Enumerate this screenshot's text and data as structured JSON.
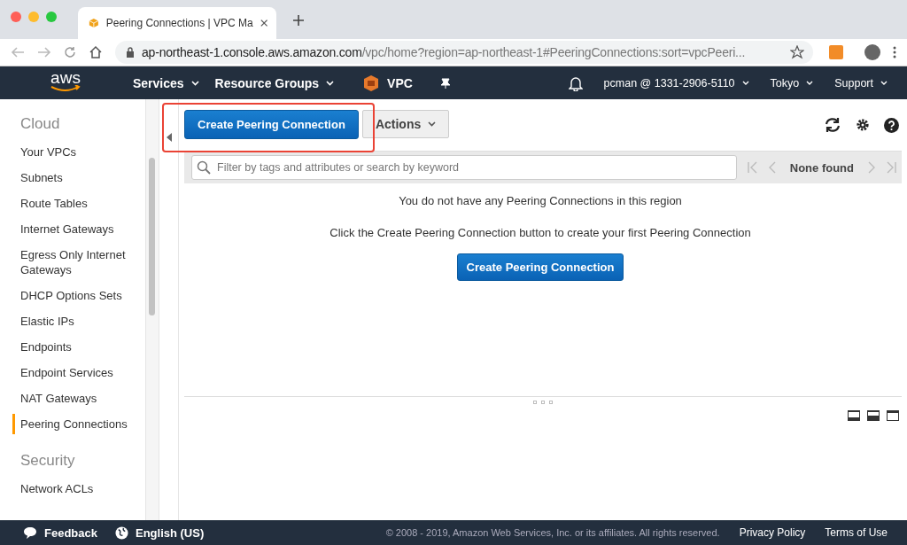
{
  "browser": {
    "tab_title": "Peering Connections | VPC Ma",
    "url_host": "ap-northeast-1.console.aws.amazon.com",
    "url_path": "/vpc/home?region=ap-northeast-1#PeeringConnections:sort=vpcPeeri..."
  },
  "nav": {
    "logo": "aws",
    "items": [
      {
        "label": "Services",
        "dropdown": true
      },
      {
        "label": "Resource Groups",
        "dropdown": true
      }
    ],
    "service": "VPC",
    "right": [
      {
        "label": "pcman @ 1331-2906-5110"
      },
      {
        "label": "Tokyo"
      },
      {
        "label": "Support"
      }
    ]
  },
  "sidebar": {
    "sections": [
      {
        "heading": "Cloud",
        "items": [
          {
            "label": "Your VPCs",
            "selected": false
          },
          {
            "label": "Subnets",
            "selected": false
          },
          {
            "label": "Route Tables",
            "selected": false
          },
          {
            "label": "Internet Gateways",
            "selected": false
          },
          {
            "label": "Egress Only Internet Gateways",
            "selected": false
          },
          {
            "label": "DHCP Options Sets",
            "selected": false
          },
          {
            "label": "Elastic IPs",
            "selected": false
          },
          {
            "label": "Endpoints",
            "selected": false
          },
          {
            "label": "Endpoint Services",
            "selected": false
          },
          {
            "label": "NAT Gateways",
            "selected": false
          },
          {
            "label": "Peering Connections",
            "selected": true
          }
        ]
      },
      {
        "heading": "Security",
        "items": [
          {
            "label": "Network ACLs",
            "selected": false
          }
        ]
      }
    ]
  },
  "toolbar": {
    "primary_button": "Create Peering Connection",
    "actions_button": "Actions",
    "highlighted": true
  },
  "filter": {
    "placeholder": "Filter by tags and attributes or search by keyword",
    "pager": "None found"
  },
  "empty_state": {
    "message": "You do not have any Peering Connections in this region",
    "hint": "Click the Create Peering Connection button to create your first Peering Connection",
    "button": "Create Peering Connection"
  },
  "footer": {
    "feedback": "Feedback",
    "language": "English (US)",
    "copyright": "© 2008 - 2019, Amazon Web Services, Inc. or its affiliates. All rights reserved.",
    "links": [
      "Privacy Policy",
      "Terms of Use"
    ]
  }
}
